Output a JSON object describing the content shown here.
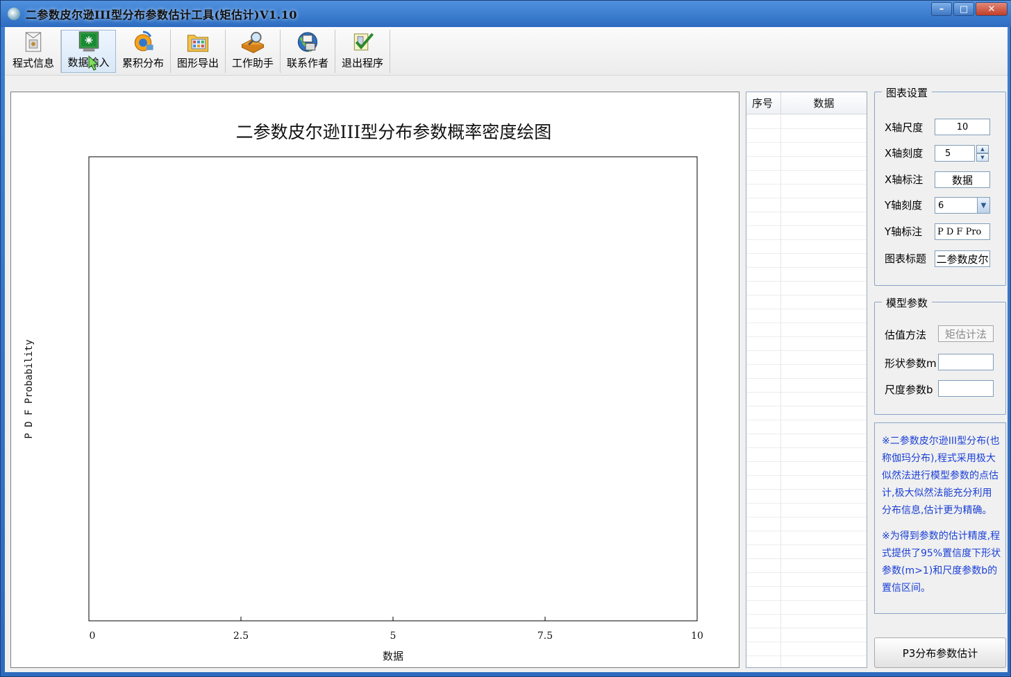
{
  "window": {
    "title": "二参数皮尔逊III型分布参数估计工具(矩估计)V1.10",
    "min_label": "–",
    "max_label": "□",
    "close_label": "✕"
  },
  "toolbar": {
    "items": [
      {
        "label": "程式信息",
        "icon": "info-doc-icon"
      },
      {
        "label": "数据输入",
        "icon": "data-input-icon"
      },
      {
        "label": "累积分布",
        "icon": "cumulative-icon"
      },
      {
        "label": "图形导出",
        "icon": "export-icon"
      },
      {
        "label": "工作助手",
        "icon": "helper-icon"
      },
      {
        "label": "联系作者",
        "icon": "contact-icon"
      },
      {
        "label": "退出程序",
        "icon": "exit-icon"
      }
    ]
  },
  "chart_data": {
    "type": "line",
    "title": "二参数皮尔逊III型分布参数概率密度绘图",
    "xlabel": "数据",
    "ylabel": "P D F  Probability",
    "xlim": [
      0,
      10
    ],
    "x_ticks": [
      "0",
      "2.5",
      "5",
      "7.5",
      "10"
    ],
    "x_tick_values": [
      0,
      2.5,
      5,
      7.5,
      10
    ],
    "series": []
  },
  "grid": {
    "col_index": "序号",
    "col_data": "数据"
  },
  "chart_settings": {
    "title": "图表设置",
    "x_scale_label": "X轴尺度",
    "x_scale_value": "10",
    "x_tick_label": "X轴刻度",
    "x_tick_value": "5",
    "x_title_label": "X轴标注",
    "x_title_value": "数据",
    "y_tick_label": "Y轴刻度",
    "y_tick_value": "6",
    "y_title_label": "Y轴标注",
    "y_title_value": "P D F  Pro",
    "chart_title_label": "图表标题",
    "chart_title_value": "二参数皮尔"
  },
  "model_params": {
    "title": "模型参数",
    "method_label": "估值方法",
    "method_value": "矩估计法",
    "shape_label": "形状参数m",
    "shape_value": "",
    "scale_label": "尺度参数b",
    "scale_value": ""
  },
  "info": {
    "p1": "※二参数皮尔逊III型分布(也称伽玛分布),程式采用极大似然法进行模型参数的点估计,极大似然法能充分利用分布信息,估计更为精确。",
    "p2": "※为得到参数的估计精度,程式提供了95%置信度下形状参数(m>1)和尺度参数b的置信区间。"
  },
  "estimate_button": "P3分布参数估计"
}
